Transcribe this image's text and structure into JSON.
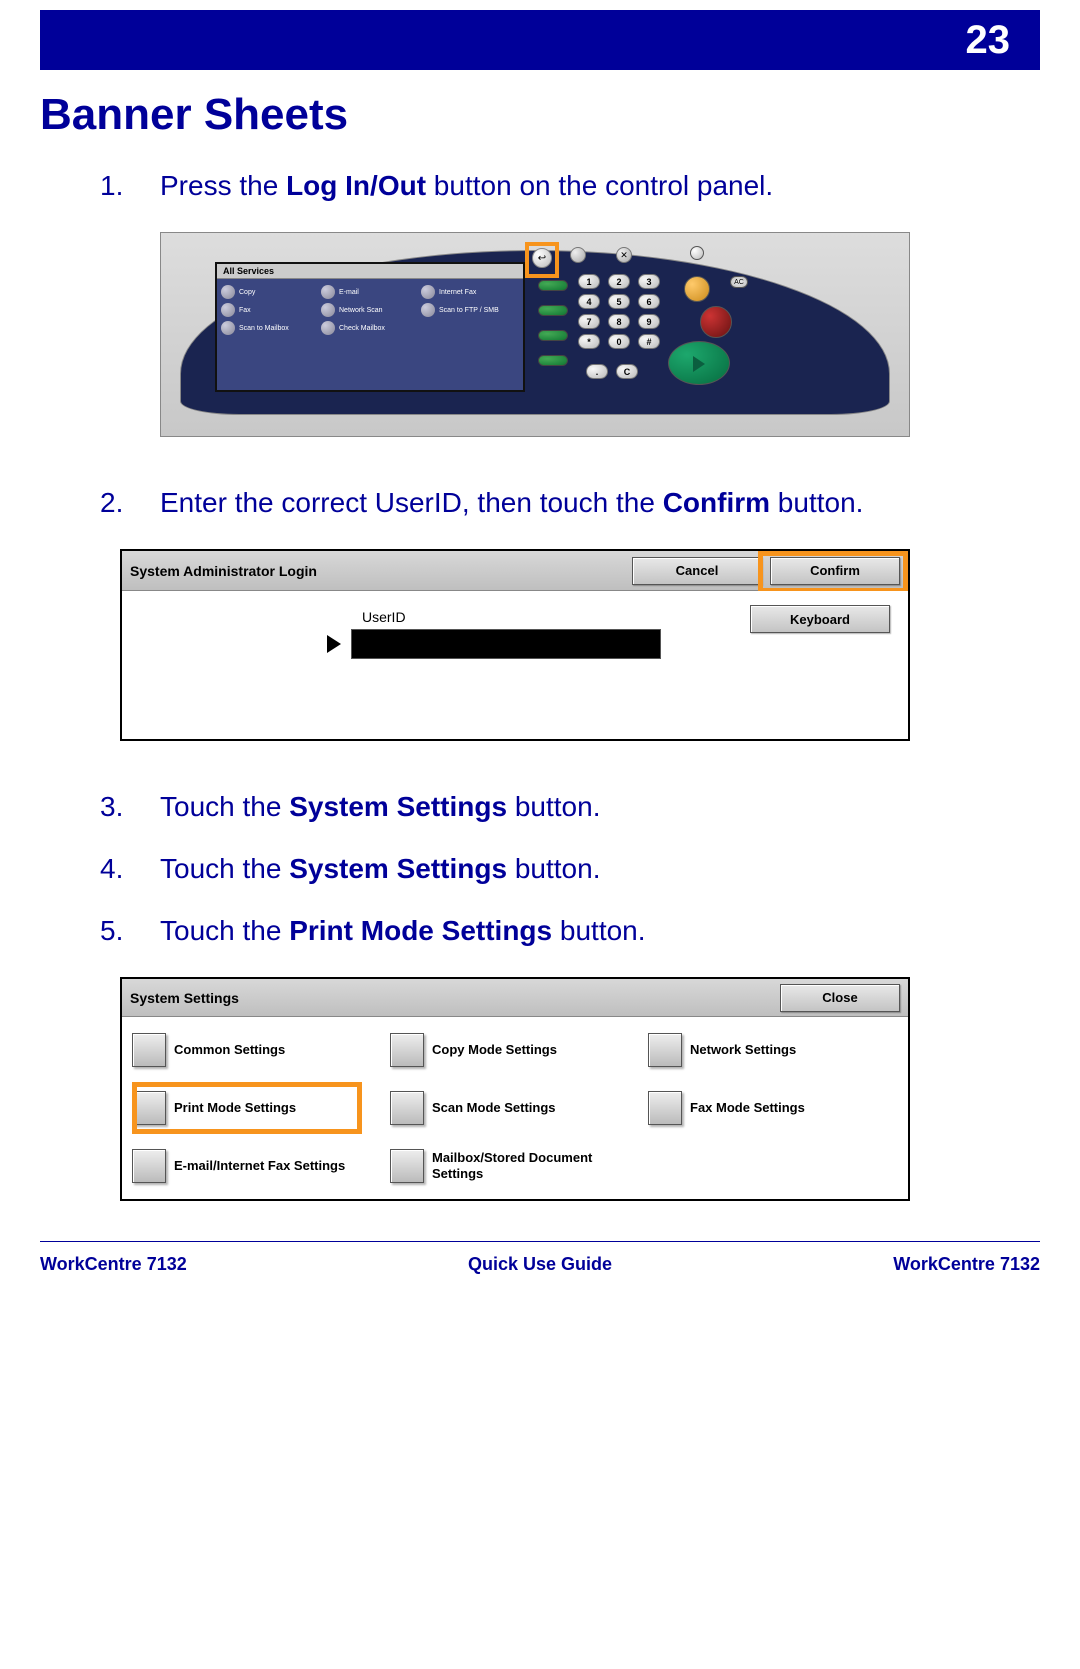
{
  "header": {
    "page_number": "23"
  },
  "title": "Banner Sheets",
  "steps": {
    "s1": {
      "num": "1.",
      "pre": "Press the ",
      "bold": "Log In/Out",
      "post": " button on the control panel."
    },
    "s2": {
      "num": "2.",
      "pre": "Enter the correct UserID, then touch the ",
      "bold": "Confirm",
      "post": " button."
    },
    "s3": {
      "num": "3.",
      "pre": "Touch the ",
      "bold": "System Settings",
      "post": " button."
    },
    "s4": {
      "num": "4.",
      "pre": "Touch the ",
      "bold": "System Settings",
      "post": " button."
    },
    "s5": {
      "num": "5.",
      "pre": "Touch the ",
      "bold": "Print Mode Settings",
      "post": " button."
    }
  },
  "panel": {
    "tab": "All Services",
    "items": [
      "Copy",
      "E-mail",
      "Internet Fax",
      "Fax",
      "Network Scan",
      "Scan to FTP / SMB",
      "Scan to Mailbox",
      "Check Mailbox"
    ],
    "keys": [
      "1",
      "2",
      "3",
      "4",
      "5",
      "6",
      "7",
      "8",
      "9",
      "*",
      "0",
      "#"
    ],
    "crow": [
      ".",
      "C"
    ],
    "small_x": "✕",
    "ac": "AC",
    "login_arrow": "↩"
  },
  "login": {
    "title": "System Administrator Login",
    "cancel": "Cancel",
    "confirm": "Confirm",
    "userid_label": "UserID",
    "keyboard": "Keyboard"
  },
  "settings": {
    "title": "System Settings",
    "close": "Close",
    "items": [
      "Common Settings",
      "Copy Mode Settings",
      "Network Settings",
      "Print Mode Settings",
      "Scan Mode Settings",
      "Fax Mode Settings",
      "E-mail/Internet Fax Settings",
      "Mailbox/Stored Document Settings"
    ]
  },
  "footer": {
    "left": "WorkCentre 7132",
    "center": "Quick Use Guide",
    "right": "WorkCentre 7132"
  }
}
